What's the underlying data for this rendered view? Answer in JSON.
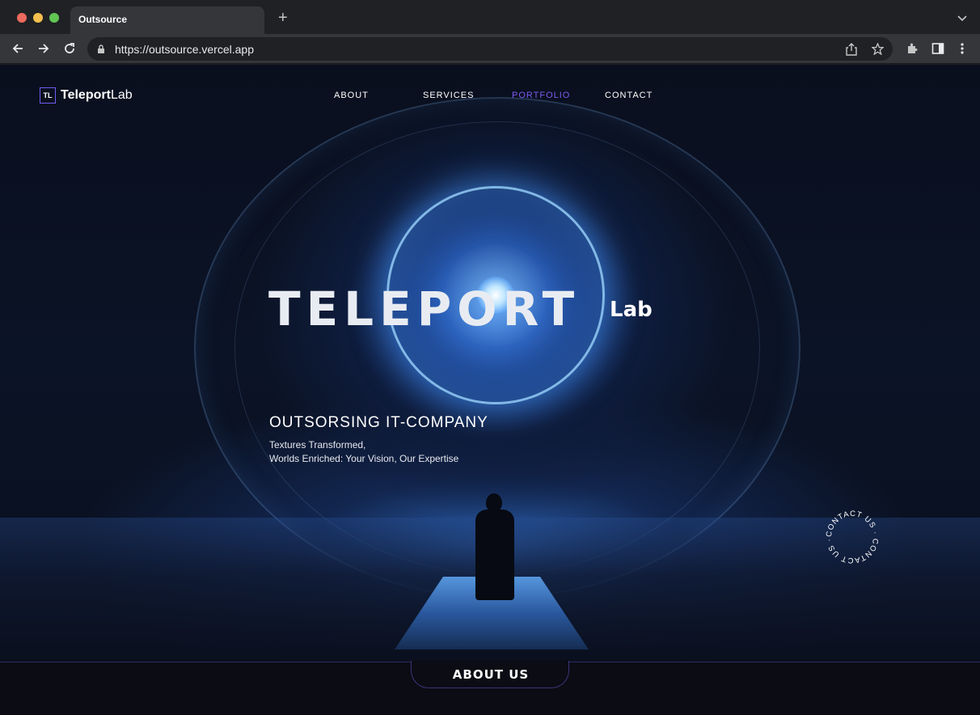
{
  "browser": {
    "tab_title": "Outsource",
    "url": "https://outsource.vercel.app"
  },
  "site": {
    "logo_mark": "TL",
    "logo_bold": "Teleport",
    "logo_light": "Lab",
    "nav": [
      {
        "label": "ABOUT"
      },
      {
        "label": "SERVICES"
      },
      {
        "label": "PORTFOLIO",
        "active": true
      },
      {
        "label": "CONTACT"
      }
    ],
    "accent_color": "#7b5cf0"
  },
  "hero": {
    "title": "TELEPORT",
    "title_suffix": "Lab",
    "subtitle": "OUTSORSING IT-COMPANY",
    "desc_line1": "Textures Transformed,",
    "desc_line2": "Worlds Enriched: Your Vision, Our Expertise",
    "contact_badge": "CONTACT US · CONTACT US ·"
  },
  "about": {
    "label": "ABOUT US"
  }
}
